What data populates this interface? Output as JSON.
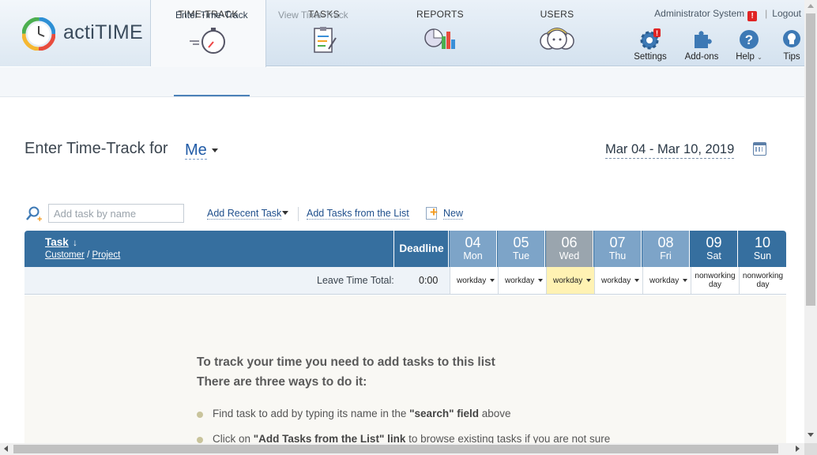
{
  "app": {
    "logo_text": "actiTIME"
  },
  "nav": {
    "tabs": [
      {
        "label": "TIME-TRACK",
        "icon": "stopwatch-icon",
        "active": true
      },
      {
        "label": "TASKS",
        "icon": "task-list-icon"
      },
      {
        "label": "REPORTS",
        "icon": "report-chart-icon"
      },
      {
        "label": "USERS",
        "icon": "users-icon"
      }
    ]
  },
  "header": {
    "user_name": "Administrator System",
    "warning": "!",
    "separator": "|",
    "logout": "Logout",
    "tools": [
      {
        "label": "Settings",
        "icon": "gear-icon",
        "has_menu": true
      },
      {
        "label": "Add-ons",
        "icon": "puzzle-icon",
        "has_menu": true
      },
      {
        "label": "Help",
        "icon": "help-icon",
        "has_menu": true
      },
      {
        "label": "Tips",
        "icon": "lightbulb-icon",
        "has_menu": false
      }
    ]
  },
  "subnav": {
    "enter": "Enter Time-Track",
    "view": "View Time-Track"
  },
  "page": {
    "title": "Enter Time-Track for",
    "user_select": "Me",
    "date_range": "Mar 04 - Mar 10, 2019"
  },
  "toolbar": {
    "search_placeholder": "Add task by name",
    "add_recent": "Add Recent Task",
    "add_from_list": "Add Tasks from the List",
    "new": "New"
  },
  "grid": {
    "task_header": "Task",
    "task_sort_arrow": "↓",
    "customer_label": "Customer",
    "project_separator": "/",
    "project_label": "Project",
    "deadline_header": "Deadline",
    "days": [
      {
        "num": "04",
        "name": "Mon",
        "status": "workday"
      },
      {
        "num": "05",
        "name": "Tue",
        "status": "workday"
      },
      {
        "num": "06",
        "name": "Wed",
        "status": "workday",
        "today": true
      },
      {
        "num": "07",
        "name": "Thu",
        "status": "workday"
      },
      {
        "num": "08",
        "name": "Fri",
        "status": "workday"
      },
      {
        "num": "09",
        "name": "Sat",
        "status": "nonworking day"
      },
      {
        "num": "10",
        "name": "Sun",
        "status": "nonworking day"
      }
    ],
    "leave_time_label": "Leave Time Total:",
    "leave_time_total": "0:00",
    "nonworking_line1": "nonworking",
    "nonworking_line2": "day"
  },
  "empty_state": {
    "line1": "To track your time you need to add tasks to this list",
    "line2": "There are three ways to do it:",
    "tip1_pre": "Find task to add by typing its name in the ",
    "tip1_bold": "\"search\" field",
    "tip1_post": " above",
    "tip2_pre": "Click on ",
    "tip2_bold": "\"Add Tasks from the List\" link",
    "tip2_post": " to browse existing tasks if you are not sure"
  },
  "colors": {
    "grid_header": "#366f9f",
    "weekday_header": "#7da4c8",
    "today_header": "#9aa5ae",
    "today_cell": "#fff2b3",
    "link": "#1f5aa6"
  }
}
